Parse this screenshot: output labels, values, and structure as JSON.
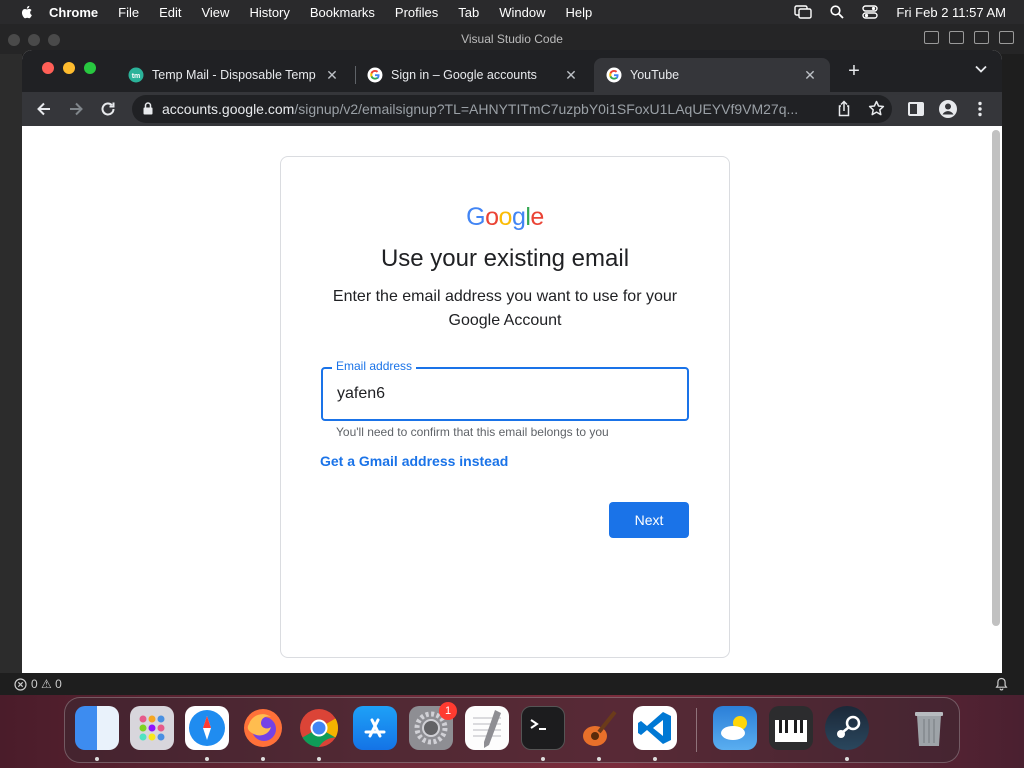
{
  "menubar": {
    "app": "Chrome",
    "items": [
      "File",
      "Edit",
      "View",
      "History",
      "Bookmarks",
      "Profiles",
      "Tab",
      "Window",
      "Help"
    ],
    "datetime": "Fri Feb 2  11:57 AM"
  },
  "vscode": {
    "title": "Visual Studio Code",
    "status": "0 ⚠ 0"
  },
  "browser": {
    "tabs": [
      {
        "label": "Temp Mail - Disposable Tempo",
        "icon": "tempmail-favicon",
        "active": false
      },
      {
        "label": "Sign in – Google accounts",
        "icon": "google-favicon",
        "active": false
      },
      {
        "label": "YouTube",
        "icon": "google-favicon",
        "active": true
      }
    ],
    "address_domain": "accounts.google.com",
    "address_path": "/signup/v2/emailsignup?TL=AHNYTITmC7uzpbY0i1SFoxU1LAqUEYVf9VM27q..."
  },
  "page": {
    "logo": [
      "G",
      "o",
      "o",
      "g",
      "l",
      "e"
    ],
    "logo_colors": [
      "#4285F4",
      "#EA4335",
      "#FBBC05",
      "#4285F4",
      "#34A853",
      "#EA4335"
    ],
    "heading": "Use your existing email",
    "subheading": "Enter the email address you want to use for your Google Account",
    "email_label": "Email address",
    "email_value": "yafen6",
    "hint": "You'll need to confirm that this email belongs to you",
    "gmail_link": "Get a Gmail address instead",
    "next_button": "Next",
    "accent": "#1a73e8"
  },
  "dock": {
    "apps": [
      "finder-icon",
      "launchpad-icon",
      "safari-icon",
      "firefox-icon",
      "chrome-icon",
      "app-store-icon",
      "system-settings-icon",
      "textedit-icon",
      "terminal-icon",
      "garageband-icon",
      "vscode-icon",
      "weather-icon",
      "piano-icon",
      "steam-icon",
      "trash-icon"
    ],
    "settings_badge": "1"
  }
}
